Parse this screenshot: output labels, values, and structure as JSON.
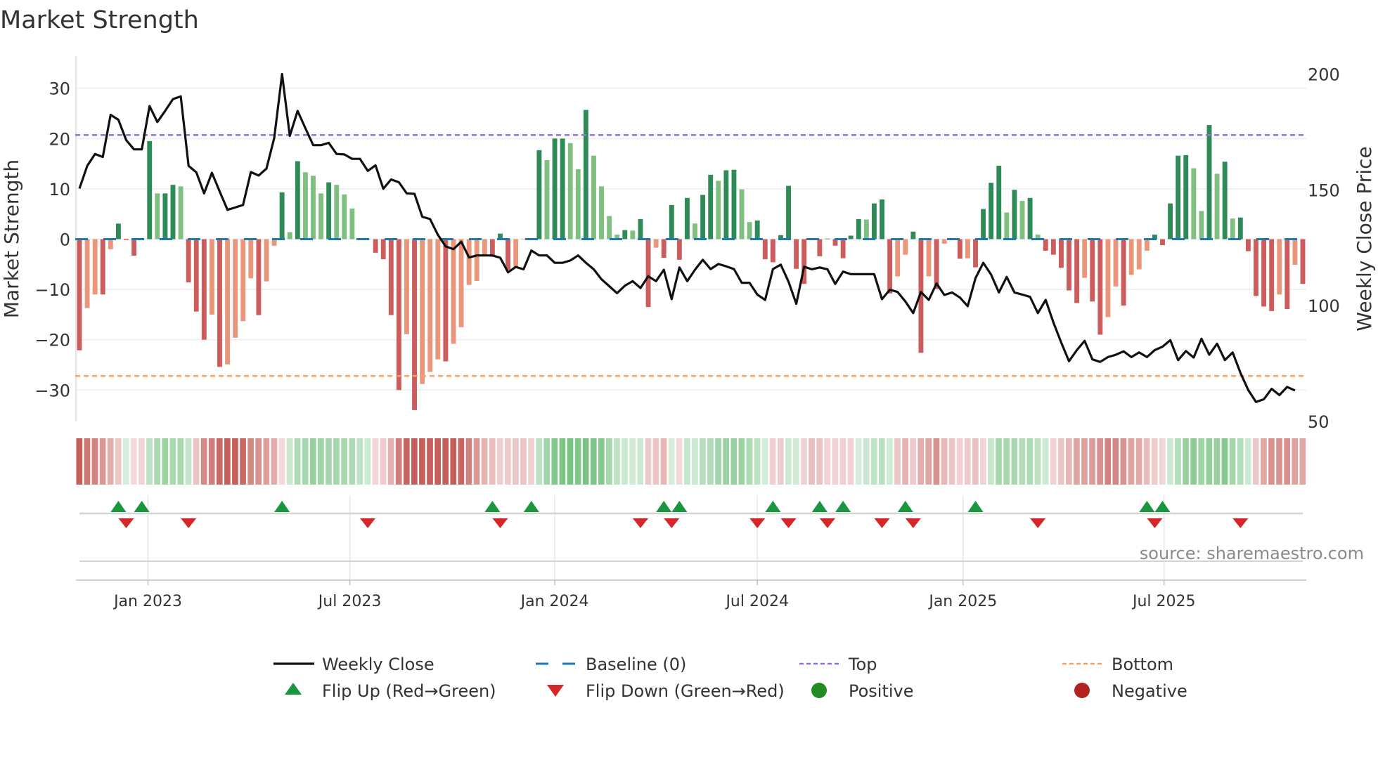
{
  "title": "Market Strength",
  "source": "source: sharemaestro.com",
  "chart_data": {
    "type": "bar",
    "title": "Market Strength",
    "ylabel": "Market Strength",
    "y2label": "Weekly Close Price",
    "ylim": [
      -36,
      36
    ],
    "y2lim": [
      50,
      200
    ],
    "yticks": [
      30,
      20,
      10,
      0,
      -10,
      -20,
      -30
    ],
    "y2ticks": [
      200,
      150,
      100,
      50
    ],
    "top_threshold": 20.7,
    "bottom_threshold": -27.2,
    "baseline": 0,
    "x_unit": "week index",
    "xticks": [
      {
        "label": "Jan 2023",
        "week": 8.8
      },
      {
        "label": "Jul 2023",
        "week": 34.7
      },
      {
        "label": "Jan 2024",
        "week": 61.0
      },
      {
        "label": "Jul 2024",
        "week": 87.0
      },
      {
        "label": "Jan 2025",
        "week": 113.4
      },
      {
        "label": "Jul 2025",
        "week": 139.2
      }
    ],
    "strength": [
      -22.1,
      -13.7,
      -11,
      -11,
      -2,
      3.1,
      -0.2,
      -3.3,
      0.2,
      19.5,
      9.1,
      9.1,
      10.8,
      10.5,
      -8.6,
      -14.4,
      -20,
      -15,
      -25.4,
      -24.9,
      -19.6,
      -16.3,
      -7.8,
      -15.1,
      -8.4,
      -1.3,
      9.3,
      1.4,
      15.5,
      13.3,
      12.6,
      9.1,
      11.3,
      10.8,
      8.9,
      6.1,
      0.1,
      -0.1,
      -2.7,
      -4.0,
      -15.1,
      -30,
      -18.9,
      -34,
      -28.8,
      -26.4,
      -23.9,
      -24.3,
      -20.8,
      -17.5,
      -9.1,
      -8.3,
      -3.2,
      -3.5,
      1.1,
      -6.1,
      -5.5,
      -0.1,
      -0.2,
      17.7,
      15.7,
      20,
      20,
      19.1,
      13.9,
      25.7,
      16.6,
      10.5,
      4.6,
      0.9,
      1.8,
      1.7,
      4.0,
      -13.5,
      -1.7,
      -3.7,
      6.8,
      -4.1,
      8.2,
      3.1,
      8.8,
      12.8,
      11.6,
      13.7,
      13.8,
      9.9,
      3.4,
      3.7,
      -4.0,
      -4.6,
      0.8,
      10.6,
      -5.9,
      -8.9,
      -0.1,
      -3.4,
      0.1,
      -1.3,
      -3.8,
      0.7,
      4.0,
      3.9,
      7.1,
      7.9,
      -10.8,
      -7.4,
      -3.1,
      1.5,
      -22.6,
      -7.4,
      -9.9,
      -0.9,
      -0.1,
      -3.9,
      -3.8,
      -5.6,
      6.0,
      11.2,
      14.6,
      5.3,
      9.8,
      7.6,
      8.2,
      0.9,
      -2.3,
      -3.1,
      -5.7,
      -10.2,
      -12.7,
      -7.7,
      -12.4,
      -19.0,
      -15.5,
      -9.4,
      -13.2,
      -7.1,
      -6.0,
      -2.3,
      0.9,
      -1.2,
      7.1,
      16.6,
      16.7,
      14.1,
      5.6,
      22.7,
      13.0,
      15.4,
      4.1,
      4.3,
      -2.4,
      -11.3,
      -13.4,
      -14.3,
      -11.0,
      -13.9,
      -5.1,
      -8.9
    ],
    "weekly_close": [
      150.6,
      160.4,
      165.5,
      164.2,
      182.4,
      180.3,
      171.5,
      167.5,
      167.5,
      186.2,
      179.3,
      184.1,
      189.2,
      190.4,
      160.4,
      157.6,
      148.5,
      157.4,
      149.3,
      141.4,
      142.4,
      143.5,
      157.7,
      156.2,
      159.2,
      172.5,
      200,
      173.3,
      184.1,
      176.6,
      169.3,
      169.3,
      170.3,
      165.5,
      165.3,
      163.4,
      163.4,
      158.2,
      160.6,
      150.5,
      154.5,
      153.3,
      148.5,
      148.3,
      138.4,
      137.4,
      130.6,
      125.6,
      124.4,
      127.6,
      120.8,
      121.7,
      121.7,
      121.7,
      120.7,
      114.4,
      116.7,
      115.7,
      123.8,
      121.7,
      121.7,
      118.5,
      118.5,
      119.5,
      121.7,
      118.5,
      115.7,
      111.4,
      108.4,
      105.4,
      108.6,
      110.6,
      107.6,
      112.7,
      110.6,
      115.5,
      102.8,
      116.5,
      110.6,
      115.5,
      119.8,
      115.8,
      118,
      117,
      115.8,
      109.9,
      109.9,
      104.8,
      102.5,
      115.8,
      117.7,
      110.4,
      100.8,
      116.8,
      115.7,
      116.5,
      115.7,
      109.4,
      114.7,
      113.6,
      113.6,
      113.6,
      113.6,
      102.8,
      106.9,
      105.9,
      101.8,
      96.8,
      105.9,
      102.5,
      109.6,
      104.6,
      105.7,
      103.5,
      99.8,
      111.9,
      118.5,
      113.4,
      105.7,
      112.4,
      105.7,
      104.8,
      103.8,
      96.8,
      102.5,
      92.7,
      84.1,
      76.0,
      80.8,
      84.8,
      76.8,
      75.7,
      77.8,
      78.8,
      80.3,
      77.8,
      79.8,
      77.8,
      80.8,
      82.3,
      85.1,
      76.5,
      80.4,
      77.6,
      85.7,
      78.8,
      83.6,
      76.5,
      79.8,
      71.0,
      63.6,
      58.4,
      59.6,
      64.1,
      61.4,
      64.9,
      63.4
    ],
    "flip_up_weeks": [
      5,
      8,
      26,
      53,
      58,
      75,
      77,
      89,
      95,
      98,
      106,
      115,
      137,
      139
    ],
    "flip_down_weeks": [
      6,
      14,
      37,
      54,
      72,
      76,
      87,
      91,
      96,
      103,
      107,
      123,
      138,
      149
    ],
    "legend": {
      "placement": "bottom",
      "items": [
        {
          "key": "close",
          "label": "Weekly Close"
        },
        {
          "key": "baseline",
          "label": "Baseline (0)"
        },
        {
          "key": "top",
          "label": "Top"
        },
        {
          "key": "bottom",
          "label": "Bottom"
        },
        {
          "key": "flip_up",
          "label": "Flip Up (Red→Green)"
        },
        {
          "key": "flip_down",
          "label": "Flip Down (Green→Red)"
        },
        {
          "key": "positive",
          "label": "Positive"
        },
        {
          "key": "negative",
          "label": "Negative"
        }
      ]
    },
    "colors": {
      "pos_dark": "#2e8b57",
      "pos_light": "#7fbf7f",
      "neg_dark": "#cd5c5c",
      "neg_light": "#e9967a",
      "close": "#111111",
      "baseline": "#1f77b4",
      "top": "#9370db",
      "bottom": "#f4a460",
      "flip_up": "#1a9641",
      "flip_down": "#d62728",
      "positive": "#228b22",
      "negative": "#b22222"
    }
  }
}
